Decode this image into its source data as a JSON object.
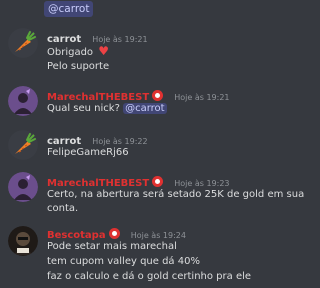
{
  "top": {
    "mention": "@carrot"
  },
  "messages": [
    {
      "author": "carrot",
      "timestamp": "Hoje às 19:21",
      "lines": [
        "Obrigado",
        "Pelo suporte"
      ],
      "emoji": "red-heart"
    },
    {
      "author": "MarechalTHEBEST",
      "timestamp": "Hoje às 19:21",
      "line_text": "Qual seu nick?",
      "mention": "@carrot"
    },
    {
      "author": "carrot",
      "timestamp": "Hoje às 19:22",
      "lines": [
        "FelipeGameRj66"
      ]
    },
    {
      "author": "MarechalTHEBEST",
      "timestamp": "Hoje às 19:23",
      "lines": [
        "Certo, na abertura será setado 25K de gold em sua",
        "conta."
      ]
    },
    {
      "author": "Bescotapa",
      "timestamp": "Hoje às 19:24",
      "lines": [
        "Pode setar mais marechal",
        "tem cupom valley que dá 40%",
        "faz o calculo e dá o gold certinho pra ele"
      ]
    }
  ],
  "colors": {
    "background": "#36393f",
    "text": "#dcddde",
    "role_red": "#e03131",
    "mention_bg": "#414675",
    "mention_text": "#c9cdfb",
    "timestamp": "#8e9297"
  }
}
